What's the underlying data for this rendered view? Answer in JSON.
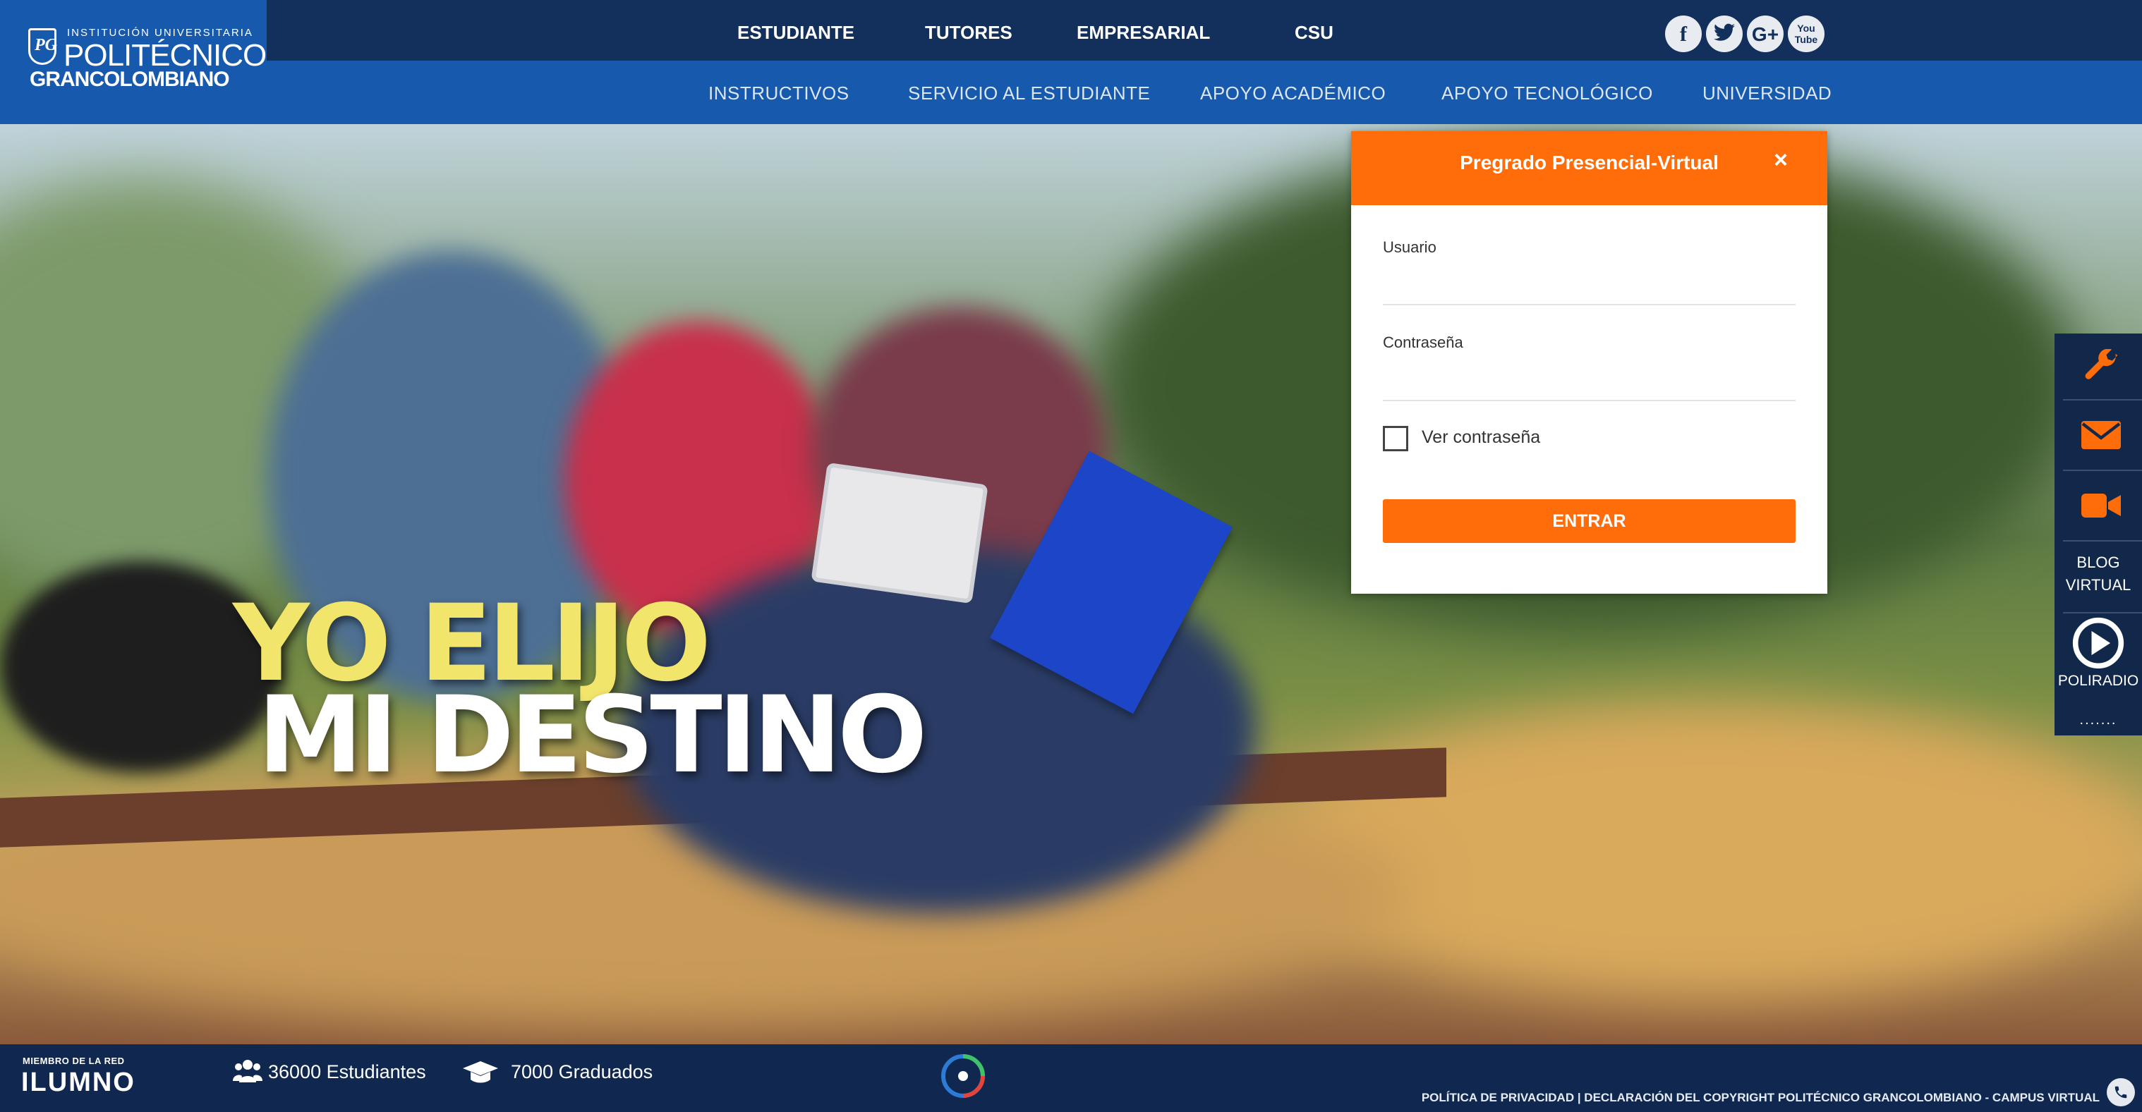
{
  "brand": {
    "line1": "INSTITUCIÓN UNIVERSITARIA",
    "line2": "POLITÉCNICO",
    "line3": "GRANCOLOMBIANO",
    "monogram": "PG",
    "color_primary": "#1659ad",
    "color_dark": "#13305d",
    "color_accent": "#ff6d0b"
  },
  "top_nav": [
    "ESTUDIANTE",
    "TUTORES",
    "EMPRESARIAL",
    "CSU"
  ],
  "social": [
    {
      "icon": "facebook-icon",
      "glyph": "f"
    },
    {
      "icon": "twitter-icon"
    },
    {
      "icon": "google-plus-icon",
      "glyph": "G+"
    },
    {
      "icon": "youtube-icon",
      "glyph": "You Tube"
    }
  ],
  "sub_nav": [
    "INSTRUCTIVOS",
    "SERVICIO AL ESTUDIANTE",
    "APOYO ACADÉMICO",
    "APOYO TECNOLÓGICO",
    "UNIVERSIDAD"
  ],
  "hero": {
    "headline_1": "YO ELIJO",
    "headline_2": "MI DESTINO"
  },
  "login": {
    "title": "Pregrado Presencial-Virtual",
    "close": "×",
    "usuario_label": "Usuario",
    "usuario_value": "",
    "password_label": "Contraseña",
    "password_value": "",
    "show_password_label": "Ver contraseña",
    "show_password_checked": false,
    "submit": "ENTRAR"
  },
  "sidebar": {
    "items": [
      {
        "icon": "wrench-icon"
      },
      {
        "icon": "envelope-icon"
      },
      {
        "icon": "video-camera-icon"
      },
      {
        "icon": "blog",
        "line1": "BLOG",
        "line2": "VIRTUAL"
      },
      {
        "icon": "play-circle-icon",
        "label": "POLIRADIO"
      }
    ],
    "more": "......."
  },
  "footer": {
    "network_label": "MIEMBRO DE LA RED",
    "network_name": "ILUMNO",
    "students": "36000 Estudiantes",
    "graduates": "7000 Graduados",
    "legal": "POLÍTICA DE PRIVACIDAD | DECLARACIÓN DEL COPYRIGHT POLITÉCNICO GRANCOLOMBIANO - CAMPUS VIRTUAL"
  }
}
